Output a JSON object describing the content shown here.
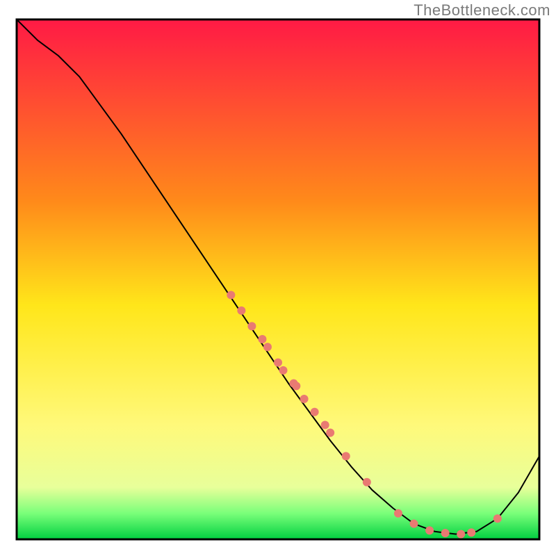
{
  "watermark_text": "TheBottleneck.com",
  "chart_data": {
    "type": "line",
    "title": "",
    "xlabel": "",
    "ylabel": "",
    "xlim": [
      0,
      100
    ],
    "ylim": [
      0,
      100
    ],
    "gradient_stops": [
      {
        "offset": 0,
        "color": "#ff1a45"
      },
      {
        "offset": 35,
        "color": "#ff8a1a"
      },
      {
        "offset": 55,
        "color": "#ffe61a"
      },
      {
        "offset": 78,
        "color": "#fff97a"
      },
      {
        "offset": 90,
        "color": "#e8ff9a"
      },
      {
        "offset": 95,
        "color": "#7aff7a"
      },
      {
        "offset": 100,
        "color": "#00d040"
      }
    ],
    "series": [
      {
        "name": "curve",
        "color": "#000000",
        "stroke_width": 2,
        "x": [
          0,
          4,
          8,
          12,
          16,
          20,
          24,
          28,
          32,
          36,
          40,
          44,
          48,
          52,
          56,
          60,
          64,
          68,
          72,
          76,
          80,
          84,
          88,
          92,
          96,
          100
        ],
        "y": [
          100,
          96,
          93,
          89,
          83.5,
          78,
          72,
          66,
          60,
          54,
          48,
          42,
          36,
          30,
          24.5,
          19,
          14,
          9.5,
          6,
          3,
          1.5,
          1,
          1.5,
          4,
          9,
          16
        ]
      }
    ],
    "scatter": {
      "name": "points",
      "color": "#e97a72",
      "radius": 6,
      "x": [
        41,
        43,
        45,
        47,
        48,
        50,
        51,
        53,
        53.5,
        55,
        57,
        59,
        60,
        63,
        67,
        73,
        76,
        79,
        82,
        85,
        87,
        92
      ],
      "y": [
        47,
        44,
        41,
        38.5,
        37,
        34,
        32.5,
        30,
        29.5,
        27,
        24.5,
        22,
        20.5,
        16,
        11,
        5,
        3,
        1.7,
        1.2,
        1,
        1.3,
        4
      ]
    },
    "border": {
      "color": "#000000",
      "width": 3
    }
  }
}
